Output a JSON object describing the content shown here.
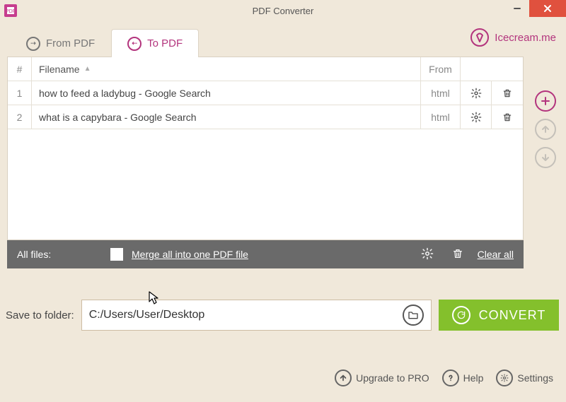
{
  "window": {
    "title": "PDF Converter"
  },
  "tabs": {
    "from_pdf": "From PDF",
    "to_pdf": "To PDF",
    "active": "to_pdf"
  },
  "brand": {
    "label": "Icecream.me"
  },
  "table": {
    "headers": {
      "idx": "#",
      "filename": "Filename",
      "from": "From"
    },
    "rows": [
      {
        "idx": "1",
        "name": "how to feed a ladybug - Google Search",
        "from": "html"
      },
      {
        "idx": "2",
        "name": "what is a capybara - Google Search",
        "from": "html"
      }
    ]
  },
  "footer": {
    "all_files": "All files:",
    "merge_label": "Merge all into one PDF file",
    "merge_checked": false,
    "clear_all": "Clear all"
  },
  "save": {
    "label": "Save to folder:",
    "path": "C:/Users/User/Desktop"
  },
  "convert": {
    "label": "CONVERT"
  },
  "bottom_links": {
    "upgrade": "Upgrade to PRO",
    "help": "Help",
    "settings": "Settings"
  }
}
